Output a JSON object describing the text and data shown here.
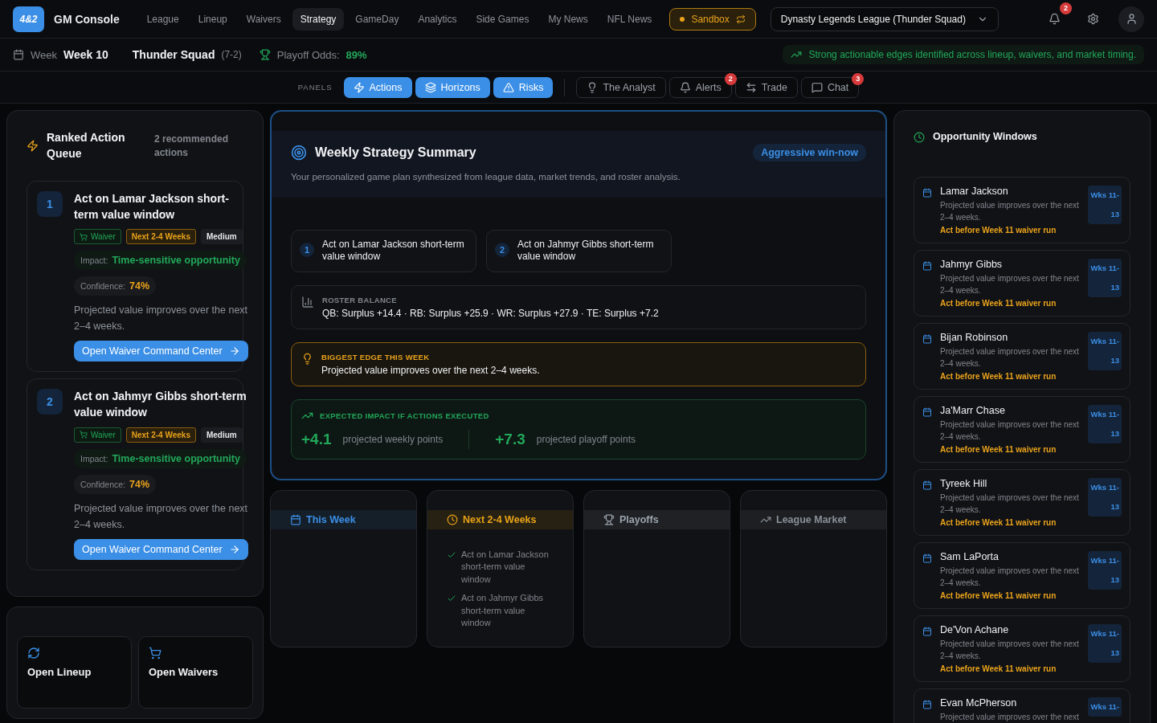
{
  "app": {
    "logo": "4&2",
    "title": "GM Console"
  },
  "nav": [
    {
      "label": "League",
      "selected": false
    },
    {
      "label": "Lineup",
      "selected": false
    },
    {
      "label": "Waivers",
      "selected": false
    },
    {
      "label": "Strategy",
      "selected": true
    },
    {
      "label": "GameDay",
      "selected": false
    },
    {
      "label": "Analytics",
      "selected": false
    },
    {
      "label": "Side Games",
      "selected": false
    },
    {
      "label": "My News",
      "selected": false
    },
    {
      "label": "NFL News",
      "selected": false
    }
  ],
  "sandbox": {
    "label": "Sandbox",
    "on": true
  },
  "league_select": {
    "value": "Dynasty Legends League (Thunder Squad)"
  },
  "notifications": {
    "count": "2"
  },
  "status": {
    "week_label": "Week",
    "week": "Week 10",
    "team": "Thunder Squad",
    "record": "(7-2)",
    "odds_label": "Playoff Odds:",
    "odds": "89%",
    "message": "Strong actionable edges identified across lineup, waivers, and market timing."
  },
  "panels": {
    "label": "PANELS",
    "toggles": [
      {
        "label": "Actions",
        "selected": true
      },
      {
        "label": "Horizons",
        "selected": true
      },
      {
        "label": "Risks",
        "selected": true
      }
    ],
    "tools": [
      {
        "label": "The Analyst"
      },
      {
        "label": "Alerts",
        "badge": "2"
      },
      {
        "label": "Trade"
      },
      {
        "label": "Chat",
        "badge": "3"
      }
    ]
  },
  "action_queue": {
    "title": "Ranked Action Queue",
    "count": "2 recommended actions",
    "actions": [
      {
        "rank": "1",
        "title": "Act on Lamar Jackson short-term value window",
        "tags": [
          {
            "label": "Waiver",
            "kind": "type"
          },
          {
            "label": "Next 2-4 Weeks",
            "kind": "horizon"
          },
          {
            "label": "Medium",
            "kind": "level"
          }
        ],
        "impact_label": "Impact:",
        "impact": "Time-sensitive opportunity",
        "confidence_label": "Confidence:",
        "confidence": "74%",
        "note": "Projected value improves over the next 2–4 weeks.",
        "button": "Open Waiver Command Center"
      },
      {
        "rank": "2",
        "title": "Act on Jahmyr Gibbs short-term value window",
        "tags": [
          {
            "label": "Waiver",
            "kind": "type"
          },
          {
            "label": "Next 2-4 Weeks",
            "kind": "horizon"
          },
          {
            "label": "Medium",
            "kind": "level"
          }
        ],
        "impact_label": "Impact:",
        "impact": "Time-sensitive opportunity",
        "confidence_label": "Confidence:",
        "confidence": "74%",
        "note": "Projected value improves over the next 2–4 weeks.",
        "button": "Open Waiver Command Center"
      }
    ]
  },
  "quick_links": [
    {
      "label": "Open Lineup"
    },
    {
      "label": "Open Waivers"
    }
  ],
  "summary": {
    "title": "Weekly Strategy Summary",
    "mode": "Aggressive win-now",
    "subtitle": "Your personalized game plan synthesized from league data, market trends, and roster analysis.",
    "priorities": [
      {
        "rank": "1",
        "text": "Act on Lamar Jackson short-term value window"
      },
      {
        "rank": "2",
        "text": "Act on Jahmyr Gibbs short-term value window"
      }
    ],
    "roster_label": "ROSTER BALANCE",
    "roster": "QB: Surplus +14.4 · RB: Surplus +25.9 · WR: Surplus +27.9 · TE: Surplus +7.2",
    "edge_label": "BIGGEST EDGE THIS WEEK",
    "edge": "Projected value improves over the next 2–4 weeks.",
    "impact_label": "EXPECTED IMPACT IF ACTIONS EXECUTED",
    "impacts": [
      {
        "value": "+4.1",
        "label": "projected weekly points"
      },
      {
        "value": "+7.3",
        "label": "projected playoff points"
      }
    ]
  },
  "horizons": [
    {
      "title": "This Week",
      "color": "#3b8fe6"
    },
    {
      "title": "Next 2-4 Weeks",
      "color": "#e8a317",
      "items": [
        "Act on Lamar Jackson short-term value window",
        "Act on Jahmyr Gibbs short-term value window"
      ]
    },
    {
      "title": "Playoffs",
      "color": "#9aa3ad"
    },
    {
      "title": "League Market",
      "color": "#8a9099"
    }
  ],
  "opportunities": {
    "title": "Opportunity Windows",
    "items": [
      {
        "player": "Lamar Jackson",
        "note": "Projected value improves over the next 2–4 weeks.",
        "deadline": "Act before Week 11 waiver run",
        "window": "Wks 11-13"
      },
      {
        "player": "Jahmyr Gibbs",
        "note": "Projected value improves over the next 2–4 weeks.",
        "deadline": "Act before Week 11 waiver run",
        "window": "Wks 11-13"
      },
      {
        "player": "Bijan Robinson",
        "note": "Projected value improves over the next 2–4 weeks.",
        "deadline": "Act before Week 11 waiver run",
        "window": "Wks 11-13"
      },
      {
        "player": "Ja'Marr Chase",
        "note": "Projected value improves over the next 2–4 weeks.",
        "deadline": "Act before Week 11 waiver run",
        "window": "Wks 11-13"
      },
      {
        "player": "Tyreek Hill",
        "note": "Projected value improves over the next 2–4 weeks.",
        "deadline": "Act before Week 11 waiver run",
        "window": "Wks 11-13"
      },
      {
        "player": "Sam LaPorta",
        "note": "Projected value improves over the next 2–4 weeks.",
        "deadline": "Act before Week 11 waiver run",
        "window": "Wks 11-13"
      },
      {
        "player": "De'Von Achane",
        "note": "Projected value improves over the next 2–4 weeks.",
        "deadline": "Act before Week 11 waiver run",
        "window": "Wks 11-13"
      },
      {
        "player": "Evan McPherson",
        "note": "Projected value improves over the next",
        "window": "Wks 11-"
      }
    ]
  }
}
